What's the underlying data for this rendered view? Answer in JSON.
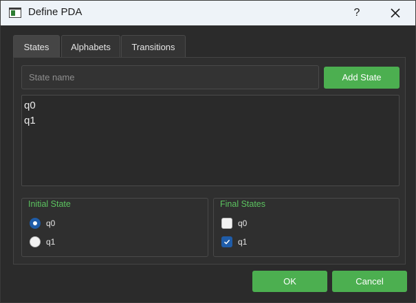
{
  "window": {
    "title": "Define PDA",
    "help_label": "?"
  },
  "tabs": [
    {
      "label": "States",
      "active": true
    },
    {
      "label": "Alphabets",
      "active": false
    },
    {
      "label": "Transitions",
      "active": false
    }
  ],
  "states_tab": {
    "state_name_placeholder": "State name",
    "state_name_value": "",
    "add_state_label": "Add State",
    "states": [
      "q0",
      "q1"
    ]
  },
  "initial_state": {
    "title": "Initial State",
    "options": [
      {
        "label": "q0",
        "selected": true
      },
      {
        "label": "q1",
        "selected": false
      }
    ]
  },
  "final_states": {
    "title": "Final States",
    "options": [
      {
        "label": "q0",
        "checked": false
      },
      {
        "label": "q1",
        "checked": true
      }
    ]
  },
  "footer": {
    "ok_label": "OK",
    "cancel_label": "Cancel"
  },
  "colors": {
    "accent_green": "#4caf50",
    "group_title_green": "#5cc460",
    "selection_blue": "#1f5ca8",
    "background": "#2b2b2b"
  },
  "icons": {
    "app": "window-app-icon",
    "close": "close-icon",
    "check": "check-icon"
  }
}
